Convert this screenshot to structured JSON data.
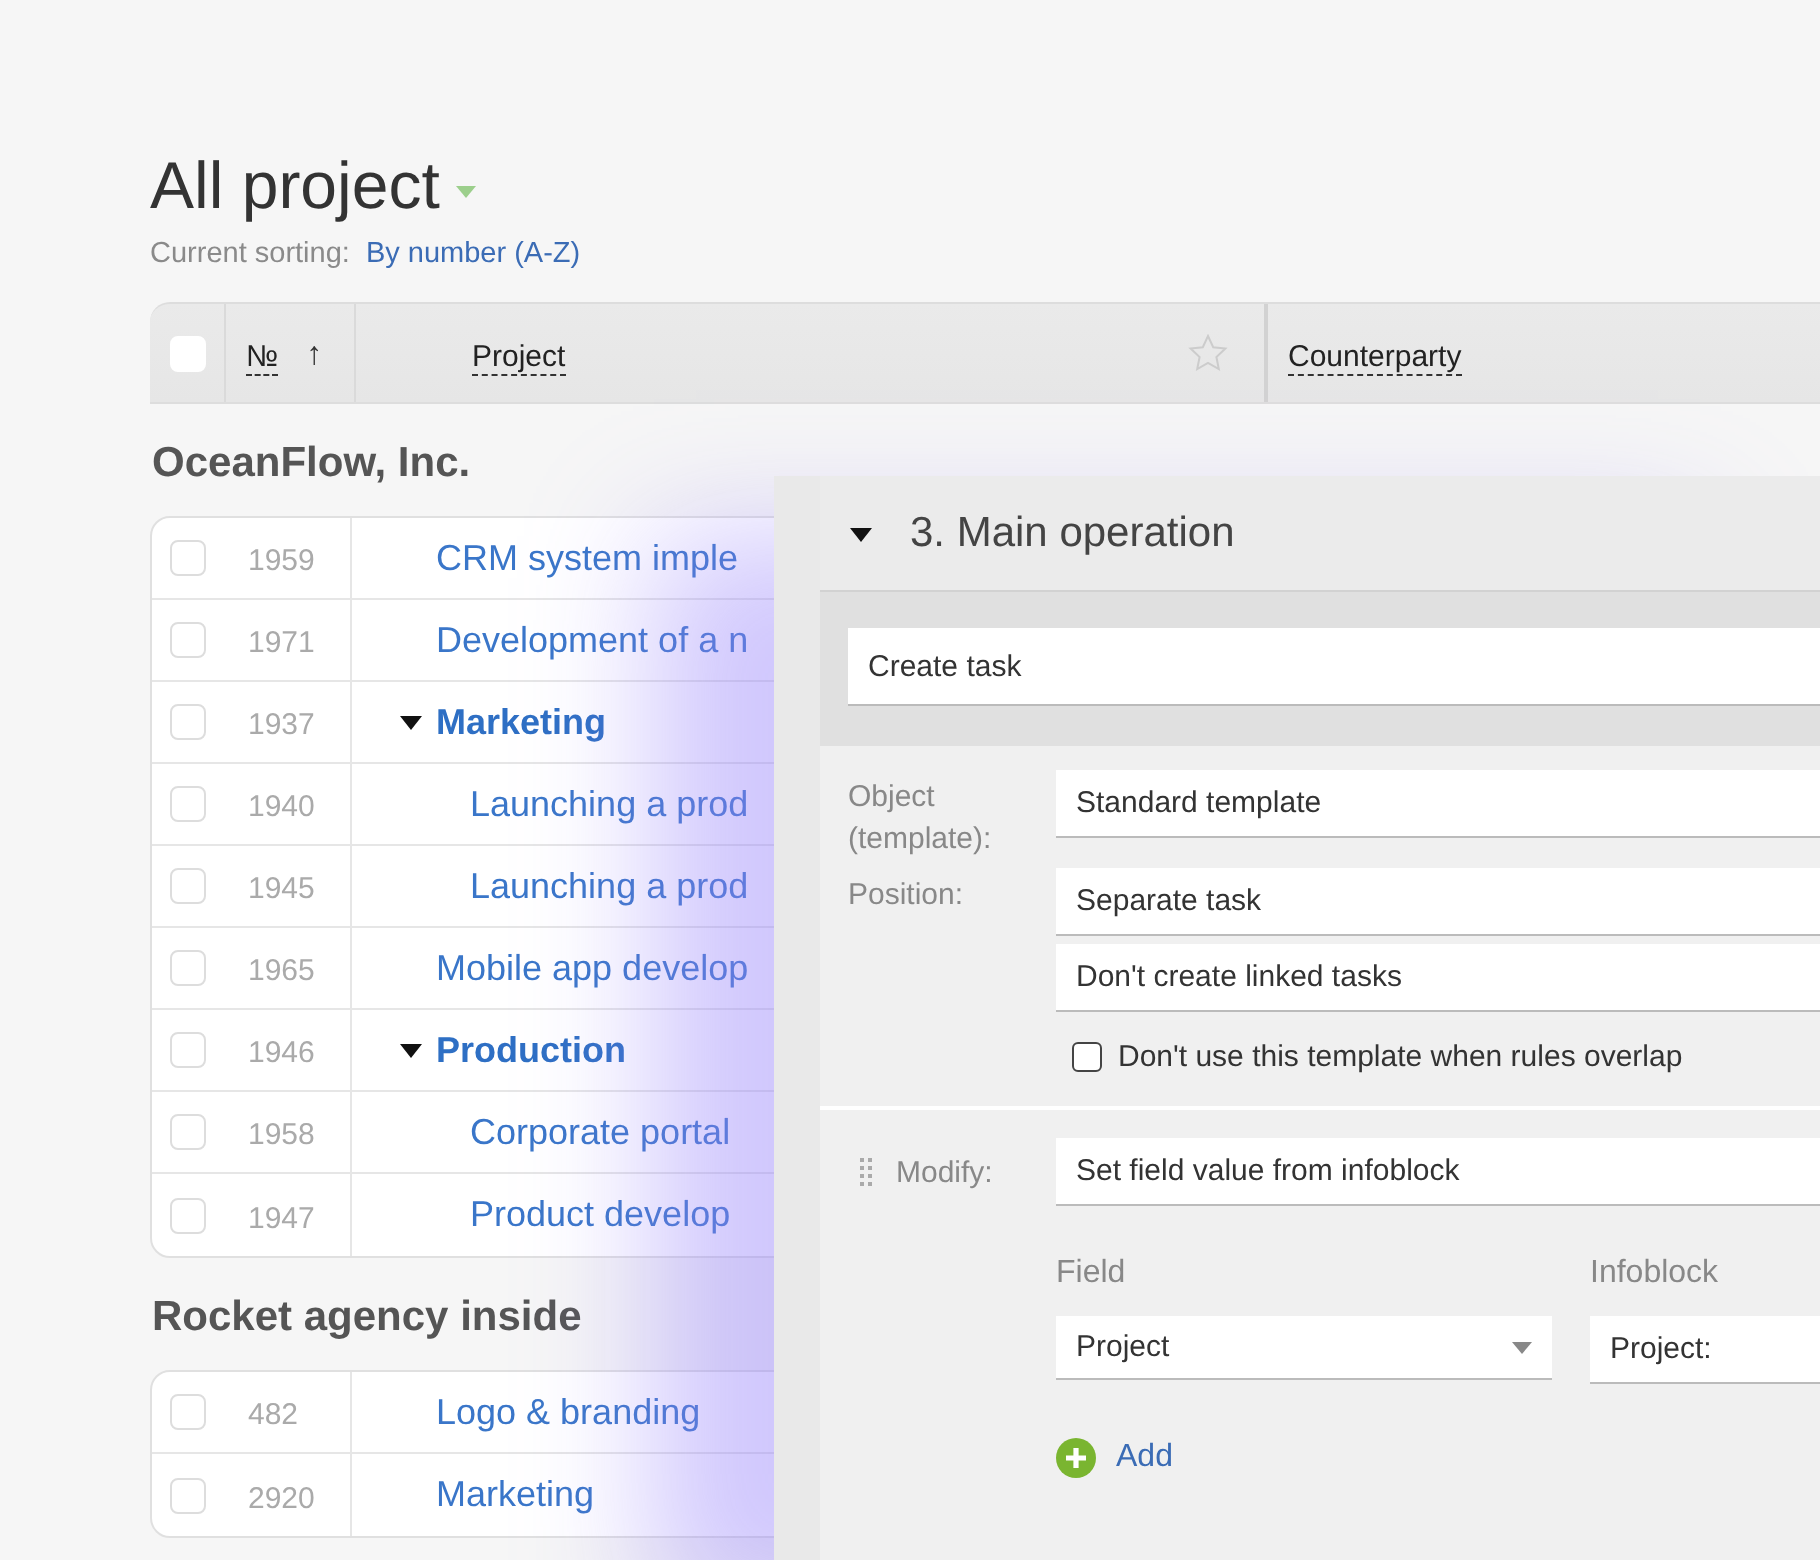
{
  "page": {
    "title": "All project",
    "sorting_label": "Current sorting:",
    "sorting_value": "By number (A-Z)"
  },
  "table": {
    "columns": [
      {
        "label": "№",
        "sort_icon": "↑"
      },
      {
        "label": "Project",
        "starred": false
      },
      {
        "label": "Counterparty"
      }
    ],
    "header_checked": false,
    "groups": [
      {
        "name": "OceanFlow, Inc.",
        "rows": [
          {
            "number": "1959",
            "project": "CRM system imple",
            "checked": false
          },
          {
            "number": "1971",
            "project": "Development of a n",
            "checked": false
          },
          {
            "number": "1937",
            "project": "Marketing",
            "checked": false,
            "expanded": true,
            "children": [
              {
                "number": "1940",
                "project": "Launching a prod",
                "checked": false
              },
              {
                "number": "1945",
                "project": "Launching a prod",
                "checked": false
              }
            ]
          },
          {
            "number": "1965",
            "project": "Mobile app develop",
            "checked": false
          },
          {
            "number": "1946",
            "project": "Production",
            "checked": false,
            "expanded": true,
            "children": [
              {
                "number": "1958",
                "project": "Corporate portal",
                "checked": false
              },
              {
                "number": "1947",
                "project": "Product develop",
                "checked": false
              }
            ]
          }
        ]
      },
      {
        "name": "Rocket agency inside",
        "rows": [
          {
            "number": "482",
            "project": "Logo & branding",
            "checked": false
          },
          {
            "number": "2920",
            "project": "Marketing",
            "checked": false
          }
        ]
      }
    ]
  },
  "panel": {
    "title": "3. Main operation",
    "expanded": true,
    "action": "Create task",
    "object_label": "Object (template):",
    "object_value": "Standard template",
    "position_label": "Position:",
    "position_value": "Separate task",
    "linked_value": "Don't create linked tasks",
    "overlap_label": "Don't use this template when rules overlap",
    "overlap_checked": false,
    "modify_label": "Modify:",
    "modify_value": "Set field value from infoblock",
    "field_label": "Field",
    "field_value": "Project",
    "infoblock_label": "Infoblock",
    "infoblock_value": "Project:",
    "add_label": "Add"
  }
}
